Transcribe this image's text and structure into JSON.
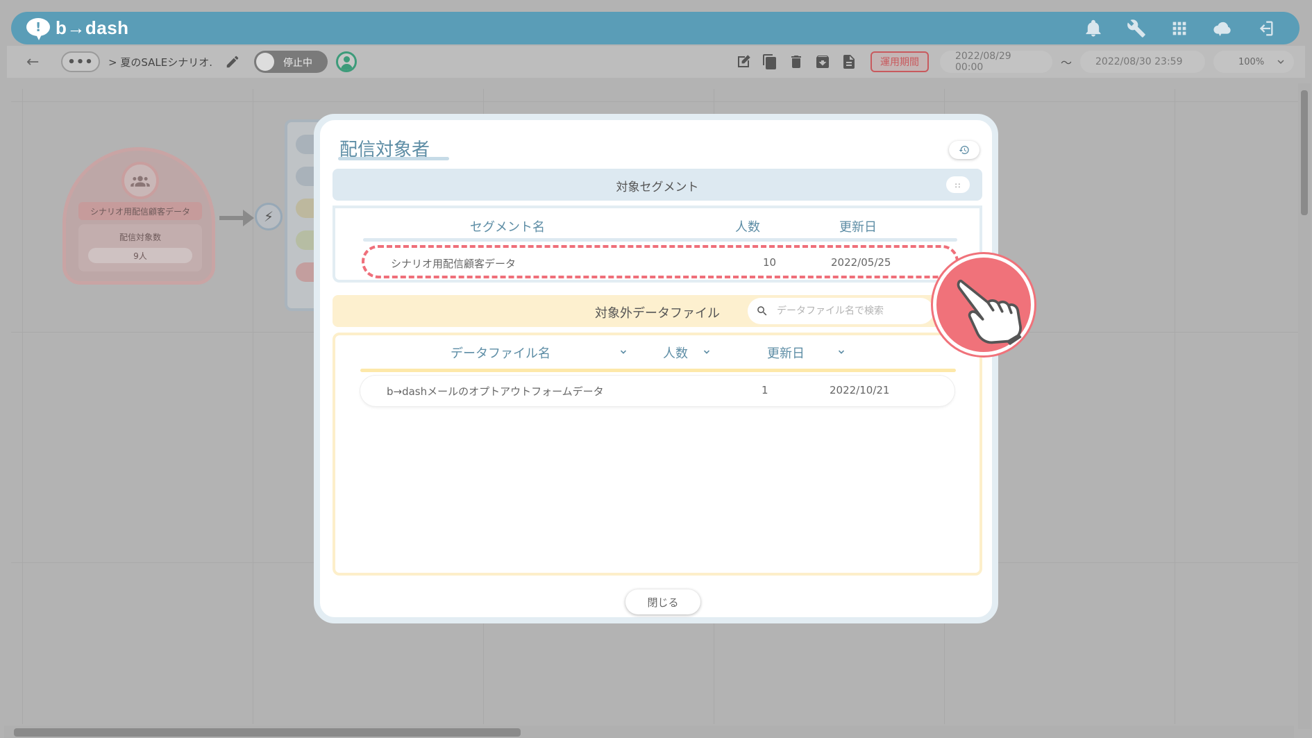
{
  "app": {
    "logo_text": "b→dash"
  },
  "header": {
    "icons": [
      "bell-icon",
      "wrench-icon",
      "grid-icon",
      "cloud-chat-icon",
      "logout-icon"
    ],
    "color": "#5a9db7"
  },
  "toolbar": {
    "dots": "•••",
    "breadcrumb": "> 夏のSALEシナリオ.",
    "status_toggle": "停止中",
    "period_button": "運用期間",
    "start_date": "2022/08/29 00:00",
    "tilde": "〜",
    "end_date": "2022/08/30 23:59",
    "zoom": "100%"
  },
  "canvas_node": {
    "title": "シナリオ用配信顧客データ",
    "label": "配信対象数",
    "value": "9人"
  },
  "modal": {
    "title": "配信対象者",
    "segment_section": {
      "title": "対象セグメント",
      "drag_handle": "::",
      "columns": [
        "セグメント名",
        "人数",
        "更新日"
      ],
      "rows": [
        {
          "name": "シナリオ用配信顧客データ",
          "count": "10",
          "updated": "2022/05/25"
        }
      ]
    },
    "excluded_section": {
      "title": "対象外データファイル",
      "search_placeholder": "データファイル名で検索",
      "columns": [
        "データファイル名",
        "人数",
        "更新日"
      ],
      "rows": [
        {
          "name": "b→dashメールのオプトアウトフォームデータ",
          "count": "1",
          "updated": "2022/10/21"
        }
      ]
    },
    "close_label": "閉じる"
  },
  "colors": {
    "accent_blue": "#5d8da5",
    "highlight_red": "#ef6f7a",
    "segment_bg": "#dde9f1",
    "excluded_bg": "#fdf0cf"
  }
}
